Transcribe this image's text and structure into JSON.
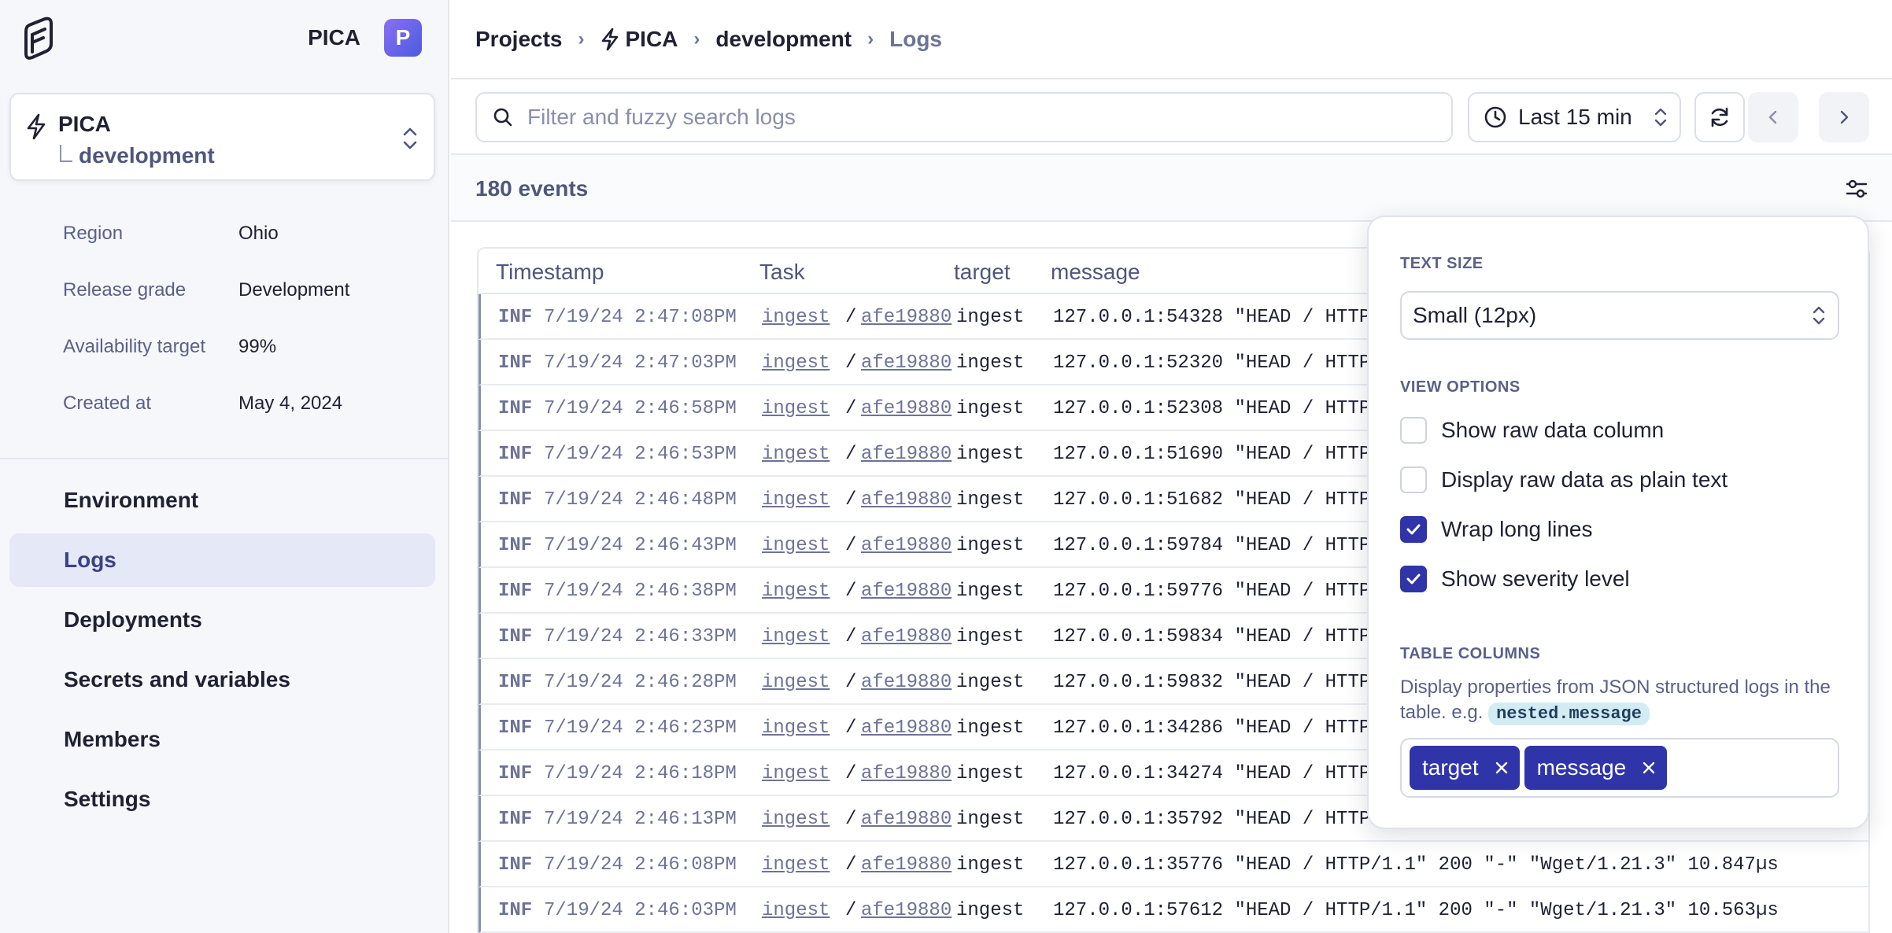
{
  "sidebar": {
    "org_name": "PICA",
    "avatar_letter": "P",
    "project": {
      "name": "PICA",
      "environment": "development"
    },
    "info": [
      {
        "label": "Region",
        "value": "Ohio"
      },
      {
        "label": "Release grade",
        "value": "Development"
      },
      {
        "label": "Availability target",
        "value": "99%"
      },
      {
        "label": "Created at",
        "value": "May 4, 2024"
      }
    ],
    "nav": [
      {
        "label": "Environment",
        "active": false
      },
      {
        "label": "Logs",
        "active": true
      },
      {
        "label": "Deployments",
        "active": false
      },
      {
        "label": "Secrets and variables",
        "active": false
      },
      {
        "label": "Members",
        "active": false
      },
      {
        "label": "Settings",
        "active": false
      }
    ]
  },
  "breadcrumb": [
    "Projects",
    "PICA",
    "development",
    "Logs"
  ],
  "toolbar": {
    "search_placeholder": "Filter and fuzzy search logs",
    "time_range": "Last 15 min"
  },
  "events": {
    "count_label": "180 events"
  },
  "log_table": {
    "columns": [
      "Timestamp",
      "Task",
      "target",
      "message"
    ],
    "rows": [
      {
        "level": "INF",
        "timestamp": "7/19/24 2:47:08PM",
        "task": "ingest",
        "task_id": "afe19880",
        "target": "ingest",
        "message": "127.0.0.1:54328 \"HEAD / HTTP"
      },
      {
        "level": "INF",
        "timestamp": "7/19/24 2:47:03PM",
        "task": "ingest",
        "task_id": "afe19880",
        "target": "ingest",
        "message": "127.0.0.1:52320 \"HEAD / HTTP"
      },
      {
        "level": "INF",
        "timestamp": "7/19/24 2:46:58PM",
        "task": "ingest",
        "task_id": "afe19880",
        "target": "ingest",
        "message": "127.0.0.1:52308 \"HEAD / HTTP"
      },
      {
        "level": "INF",
        "timestamp": "7/19/24 2:46:53PM",
        "task": "ingest",
        "task_id": "afe19880",
        "target": "ingest",
        "message": "127.0.0.1:51690 \"HEAD / HTTP"
      },
      {
        "level": "INF",
        "timestamp": "7/19/24 2:46:48PM",
        "task": "ingest",
        "task_id": "afe19880",
        "target": "ingest",
        "message": "127.0.0.1:51682 \"HEAD / HTTP"
      },
      {
        "level": "INF",
        "timestamp": "7/19/24 2:46:43PM",
        "task": "ingest",
        "task_id": "afe19880",
        "target": "ingest",
        "message": "127.0.0.1:59784 \"HEAD / HTTP"
      },
      {
        "level": "INF",
        "timestamp": "7/19/24 2:46:38PM",
        "task": "ingest",
        "task_id": "afe19880",
        "target": "ingest",
        "message": "127.0.0.1:59776 \"HEAD / HTTP"
      },
      {
        "level": "INF",
        "timestamp": "7/19/24 2:46:33PM",
        "task": "ingest",
        "task_id": "afe19880",
        "target": "ingest",
        "message": "127.0.0.1:59834 \"HEAD / HTTP"
      },
      {
        "level": "INF",
        "timestamp": "7/19/24 2:46:28PM",
        "task": "ingest",
        "task_id": "afe19880",
        "target": "ingest",
        "message": "127.0.0.1:59832 \"HEAD / HTTP"
      },
      {
        "level": "INF",
        "timestamp": "7/19/24 2:46:23PM",
        "task": "ingest",
        "task_id": "afe19880",
        "target": "ingest",
        "message": "127.0.0.1:34286 \"HEAD / HTTP"
      },
      {
        "level": "INF",
        "timestamp": "7/19/24 2:46:18PM",
        "task": "ingest",
        "task_id": "afe19880",
        "target": "ingest",
        "message": "127.0.0.1:34274 \"HEAD / HTTP"
      },
      {
        "level": "INF",
        "timestamp": "7/19/24 2:46:13PM",
        "task": "ingest",
        "task_id": "afe19880",
        "target": "ingest",
        "message": "127.0.0.1:35792 \"HEAD / HTTP/"
      },
      {
        "level": "INF",
        "timestamp": "7/19/24 2:46:08PM",
        "task": "ingest",
        "task_id": "afe19880",
        "target": "ingest",
        "message": "127.0.0.1:35776 \"HEAD / HTTP/1.1\" 200 \"-\" \"Wget/1.21.3\" 10.847µs"
      },
      {
        "level": "INF",
        "timestamp": "7/19/24 2:46:03PM",
        "task": "ingest",
        "task_id": "afe19880",
        "target": "ingest",
        "message": "127.0.0.1:57612 \"HEAD / HTTP/1.1\" 200 \"-\" \"Wget/1.21.3\" 10.563µs"
      }
    ]
  },
  "settings_popover": {
    "text_size_heading": "TEXT SIZE",
    "text_size_value": "Small (12px)",
    "view_options_heading": "VIEW OPTIONS",
    "view_options": [
      {
        "label": "Show raw data column",
        "checked": false
      },
      {
        "label": "Display raw data as plain text",
        "checked": false
      },
      {
        "label": "Wrap long lines",
        "checked": true
      },
      {
        "label": "Show severity level",
        "checked": true
      }
    ],
    "table_columns_heading": "TABLE COLUMNS",
    "table_columns_description": "Display properties from JSON structured logs in the table. e.g.",
    "table_columns_example": "nested.message",
    "columns": [
      "target",
      "message"
    ]
  },
  "colors": {
    "accent": "#2f35a8",
    "active_nav_bg": "#e5e8f7",
    "muted_text": "#5a6088"
  }
}
